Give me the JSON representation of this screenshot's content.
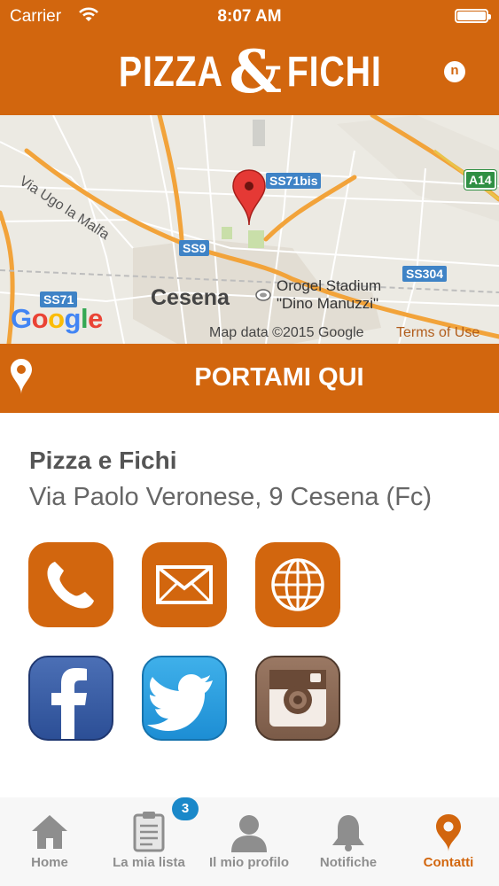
{
  "status_bar": {
    "carrier": "Carrier",
    "time": "8:07 AM"
  },
  "header": {
    "logo_word_1": "PIZZA",
    "logo_amp": "&",
    "logo_word_2": "FICHI",
    "notification_button_label": "n"
  },
  "map": {
    "city_label": "Cesena",
    "stadium_label_line1": "Orogel Stadium",
    "stadium_label_line2": "\"Dino Manuzzi\"",
    "street_label": "Via Ugo la Malfa",
    "road_labels": [
      "SS71bis",
      "SS9",
      "SS71",
      "SS304",
      "A14"
    ],
    "google_logo": [
      "G",
      "o",
      "o",
      "g",
      "l",
      "e"
    ],
    "credit": "Map data ©2015 Google",
    "terms": "Terms of Use"
  },
  "directions_button": {
    "label": "PORTAMI QUI"
  },
  "contact": {
    "name": "Pizza e Fichi",
    "address": "Via Paolo Veronese, 9 Cesena (Fc)"
  },
  "icons": {
    "phone": "phone-icon",
    "mail": "mail-icon",
    "web": "globe-icon",
    "facebook": "facebook-icon",
    "twitter": "twitter-icon",
    "instagram": "instagram-icon"
  },
  "tabbar": {
    "items": [
      {
        "label": "Home"
      },
      {
        "label": "La mia lista",
        "badge": "3"
      },
      {
        "label": "Il mio profilo"
      },
      {
        "label": "Notifiche"
      },
      {
        "label": "Contatti"
      }
    ],
    "active_index": 4
  },
  "colors": {
    "brand": "#d2660e",
    "badge": "#1a88c9",
    "tab_inactive": "#8e8e8e"
  }
}
